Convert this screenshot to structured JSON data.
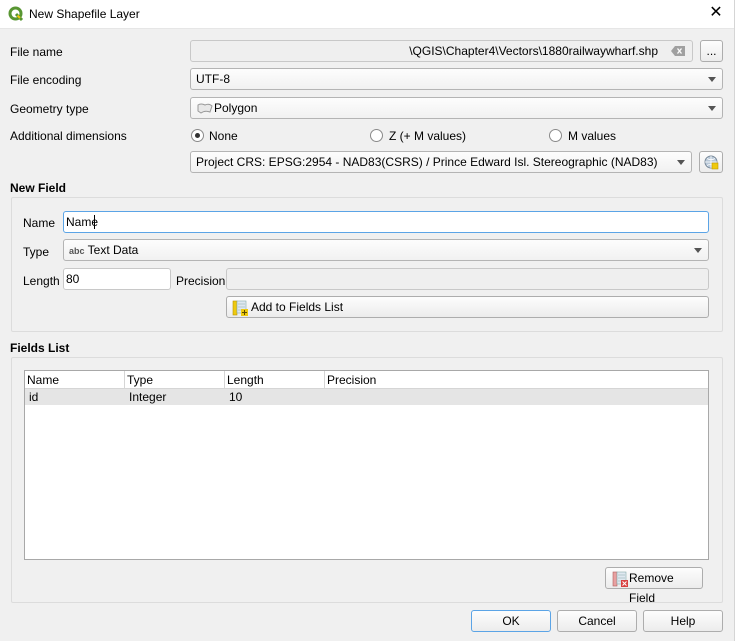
{
  "window": {
    "title": "New Shapefile Layer",
    "close_glyph": "✕"
  },
  "form": {
    "file_name_label": "File name",
    "file_name_value": "\\QGIS\\Chapter4\\Vectors\\1880railwaywharf.shp",
    "browse_label": "...",
    "file_encoding_label": "File encoding",
    "file_encoding_value": "UTF-8",
    "geometry_type_label": "Geometry type",
    "geometry_type_value": "Polygon",
    "additional_dimensions_label": "Additional dimensions",
    "dimension_options": [
      {
        "label": "None",
        "selected": true
      },
      {
        "label": "Z (+ M values)",
        "selected": false
      },
      {
        "label": "M values",
        "selected": false
      }
    ],
    "crs_value": "Project CRS: EPSG:2954 - NAD83(CSRS) / Prince Edward Isl. Stereographic (NAD83)"
  },
  "new_field": {
    "section_title": "New Field",
    "name_label": "Name",
    "name_value": "Name",
    "type_label": "Type",
    "type_prefix": "abc",
    "type_value": "Text Data",
    "length_label": "Length",
    "length_value": "80",
    "precision_label": "Precision",
    "precision_value": "",
    "add_button_label": "Add to Fields List"
  },
  "fields_list": {
    "section_title": "Fields List",
    "columns": [
      "Name",
      "Type",
      "Length",
      "Precision"
    ],
    "rows": [
      {
        "name": "id",
        "type": "Integer",
        "length": "10",
        "precision": ""
      }
    ],
    "remove_button_label": "Remove Field"
  },
  "buttons": {
    "ok": "OK",
    "cancel": "Cancel",
    "help": "Help"
  },
  "colors": {
    "accent": "#5ba4e6",
    "qgis_green": "#589632",
    "qgis_yellow": "#eec90d"
  }
}
